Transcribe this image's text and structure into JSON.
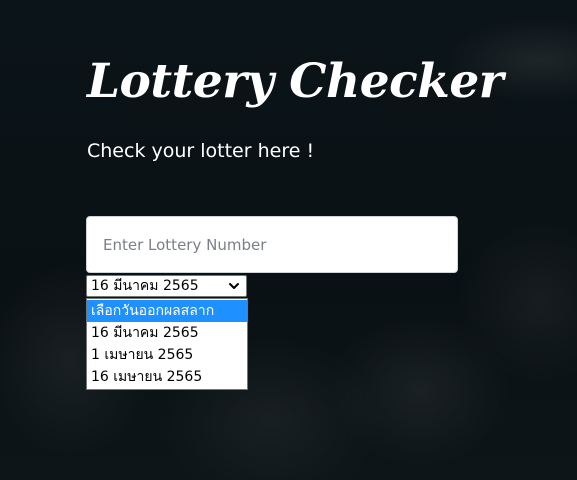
{
  "page": {
    "title": "Lottery Checker",
    "subtitle": "Check your lotter here !"
  },
  "form": {
    "lottery_input_placeholder": "Enter Lottery Number",
    "lottery_input_value": "",
    "date_select": {
      "selected": "16 มีนาคม 2565",
      "options": [
        "เลือกวันออกผลสลาก",
        "16 มีนาคม 2565",
        "1 เมษายน 2565",
        "16 เมษายน 2565"
      ],
      "highlighted_index": 0
    }
  },
  "colors": {
    "background": "#0b1216",
    "highlight": "#1e90ff",
    "text_primary": "#ffffff"
  },
  "icons": {
    "select_arrow": "chevron-down-icon"
  }
}
